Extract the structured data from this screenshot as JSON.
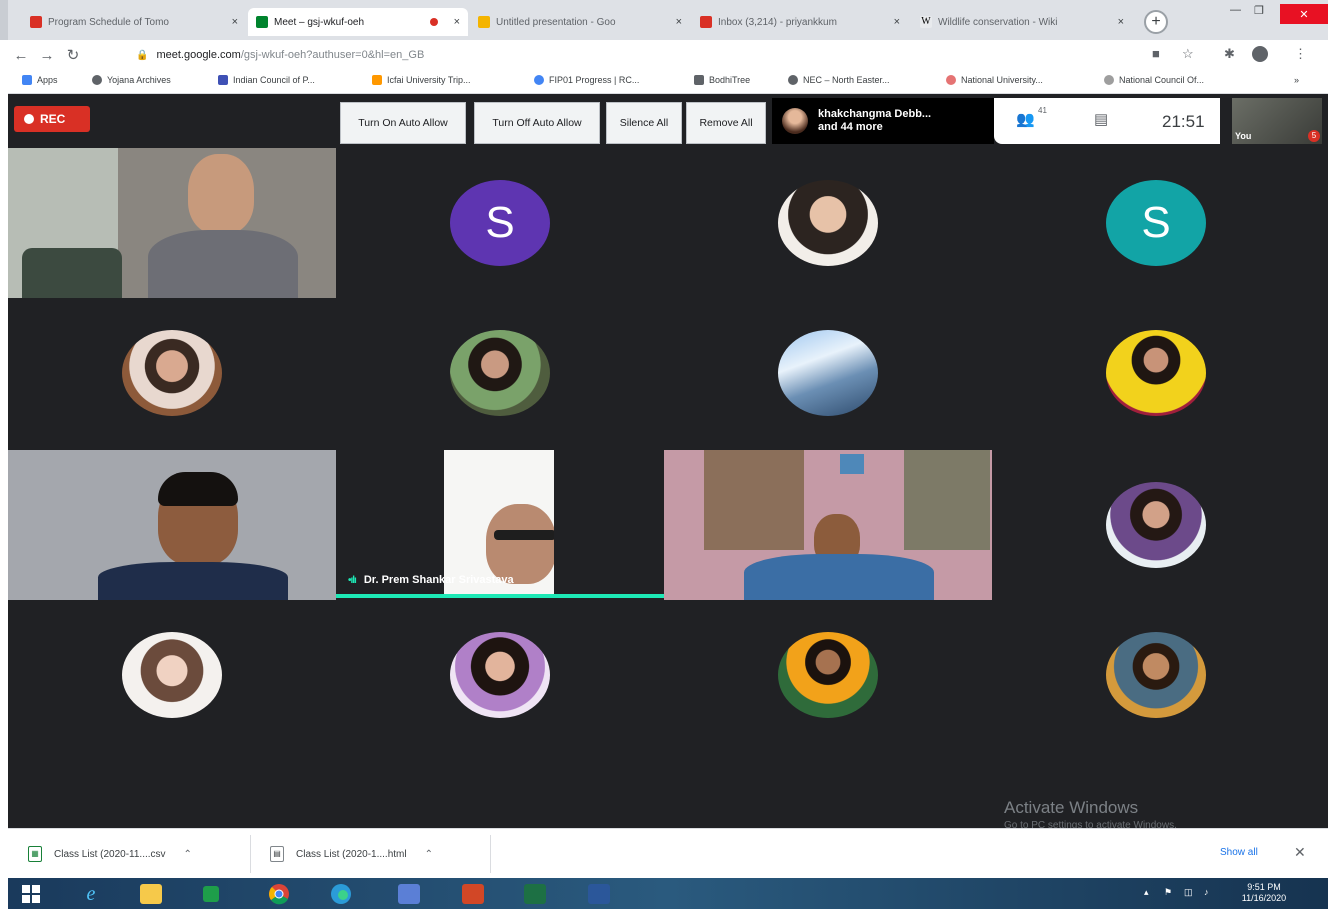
{
  "browser": {
    "tabs": [
      {
        "label": "Program Schedule of Tomo",
        "icon": "gmail-icon",
        "active": false
      },
      {
        "label": "Meet – gsj-wkuf-oeh",
        "icon": "meet-icon",
        "active": true,
        "recording": true
      },
      {
        "label": "Untitled presentation - Goo",
        "icon": "slides-icon",
        "active": false
      },
      {
        "label": "Inbox (3,214) - priyankkum",
        "icon": "gmail-icon",
        "active": false
      },
      {
        "label": "Wildlife conservation - Wiki",
        "icon": "wikipedia-icon",
        "active": false
      }
    ],
    "tab_close": "×",
    "new_tab": "+",
    "url_host": "meet.google.com",
    "url_path": "/gsj-wkuf-oeh?authuser=0&hl=en_GB",
    "bookmarks": [
      {
        "label": "Apps",
        "color": "#4285f4"
      },
      {
        "label": "Yojana Archives",
        "color": "#5f6368"
      },
      {
        "label": "Indian Council of P...",
        "color": "#3f51b5"
      },
      {
        "label": "Icfai University Trip...",
        "color": "#ff9800"
      },
      {
        "label": "FIP01 Progress | RC...",
        "color": "#4285f4"
      },
      {
        "label": "BodhiTree",
        "color": "#5f6368"
      },
      {
        "label": "NEC – North Easter...",
        "color": "#5f6368"
      },
      {
        "label": "National University...",
        "color": "#e57373"
      },
      {
        "label": "National Council Of...",
        "color": "#9e9e9e"
      }
    ]
  },
  "meet": {
    "rec_label": "REC",
    "controls": [
      "Turn On Auto Allow",
      "Turn Off Auto Allow",
      "Silence All",
      "Remove All"
    ],
    "participants_line1": "khakchangma Debb...",
    "participants_line2": "and 44 more",
    "participant_count": "41",
    "clock": "21:51",
    "self_label": "You",
    "self_badge": "5",
    "active_speaker": "Dr. Prem Shankar Srivastava",
    "letter_tiles": [
      {
        "letter": "S",
        "color": "#5e35b1"
      },
      {
        "letter": "S",
        "color": "#12a4a6"
      }
    ]
  },
  "windows": {
    "watermark_title": "Activate Windows",
    "watermark_sub": "Go to PC settings to activate Windows."
  },
  "downloads": {
    "items": [
      "Class List (2020-11....csv",
      "Class List (2020-1....html"
    ],
    "show_all": "Show all"
  },
  "taskbar": {
    "time": "9:51 PM",
    "date": "11/16/2020"
  }
}
